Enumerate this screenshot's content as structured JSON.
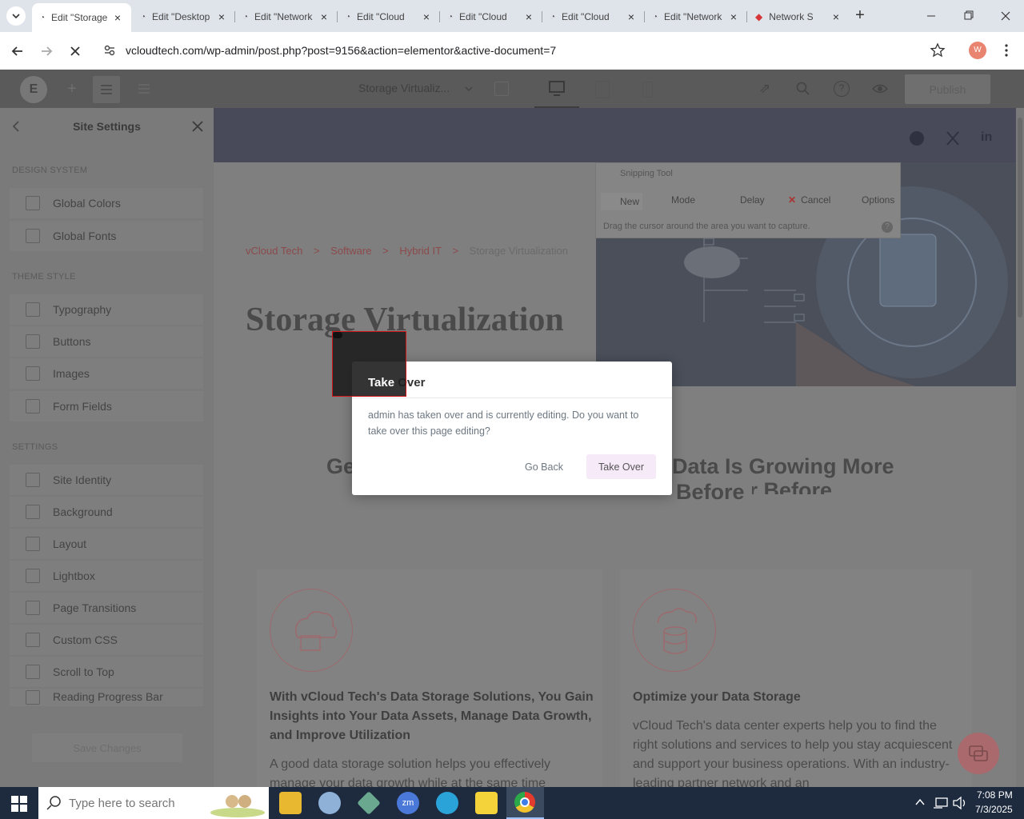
{
  "browser": {
    "tabs": [
      {
        "title": "Edit \"Storage",
        "active": true
      },
      {
        "title": "Edit \"Desktop",
        "active": false
      },
      {
        "title": "Edit \"Network",
        "active": false
      },
      {
        "title": "Edit \"Cloud",
        "active": false
      },
      {
        "title": "Edit \"Cloud",
        "active": false
      },
      {
        "title": "Edit \"Cloud",
        "active": false
      },
      {
        "title": "Edit \"Network",
        "active": false
      },
      {
        "title": "Network S",
        "active": false
      }
    ],
    "url": "vcloudtech.com/wp-admin/post.php?post=9156&action=elementor&active-document=7",
    "profile_initial": "W"
  },
  "editor": {
    "doc_title": "Storage Virtualiz...",
    "publish_label": "Publish"
  },
  "sidebar": {
    "title": "Site Settings",
    "design_system_heading": "DESIGN SYSTEM",
    "design_items": [
      "Global Colors",
      "Global Fonts"
    ],
    "theme_style_heading": "THEME STYLE",
    "theme_items": [
      "Typography",
      "Buttons",
      "Images",
      "Form Fields"
    ],
    "settings_heading": "SETTINGS",
    "settings_items": [
      "Site Identity",
      "Background",
      "Layout",
      "Lightbox",
      "Page Transitions",
      "Custom CSS",
      "Scroll to Top",
      "Reading Progress Bar"
    ],
    "save_label": "Save Changes"
  },
  "page": {
    "breadcrumb": [
      "vCloud Tech",
      "Software",
      "Hybrid IT",
      "Storage Virtualization"
    ],
    "heading": "Storage Virtualization",
    "subheading_left": "Ge",
    "subheading_right_1": "Data Is Growing More",
    "subheading_right_2": "Quickly Than Ever Before",
    "card1_title": "With vCloud Tech's Data Storage Solutions, You Gain Insights into Your Data Assets, Manage Data Growth, and Improve Utilization",
    "card1_body": "A good data storage solution helps you effectively manage your data growth while at the same time",
    "card2_title": "Optimize your Data Storage",
    "card2_body": "vCloud Tech's data center experts help you to find the right solutions and services to help you stay acquiescent and support your business operations. With an industry-leading partner network and an"
  },
  "snipping": {
    "title": "Snipping Tool",
    "new": "New",
    "mode": "Mode",
    "delay": "Delay",
    "cancel": "Cancel",
    "options": "Options",
    "hint": "Drag the cursor around the area you want to capture."
  },
  "modal": {
    "title": "Take Over",
    "message": "admin has taken over and is currently editing. Do you want to take over this page editing?",
    "go_back": "Go Back",
    "take_over": "Take Over"
  },
  "taskbar": {
    "search_placeholder": "Type here to search",
    "time": "7:08 PM",
    "date": "7/3/2025"
  },
  "colors": {
    "accent": "#d63638",
    "take_over_bg": "#f6e9f8",
    "tab_strip": "#dfe3ea",
    "taskbar": "#1e2b3f"
  }
}
